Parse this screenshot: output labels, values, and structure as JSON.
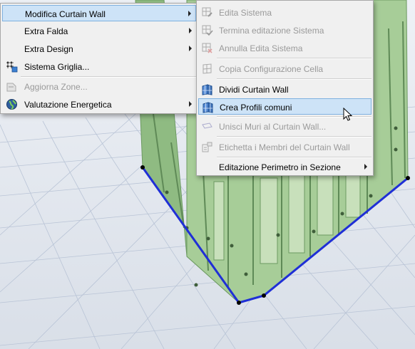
{
  "main_menu": {
    "items": [
      {
        "label": "Modifica Curtain Wall",
        "state": "highlighted",
        "submenu": true
      },
      {
        "label": "Extra Falda",
        "submenu": true
      },
      {
        "label": "Extra Design",
        "submenu": true
      },
      {
        "label": "Sistema Griglia...",
        "icon": "grid-system-icon"
      },
      {
        "label": "Aggiorna Zone...",
        "state": "disabled",
        "icon": "update-zones-icon"
      },
      {
        "label": "Valutazione Energetica",
        "submenu": true,
        "icon": "globe-icon"
      }
    ]
  },
  "sub_menu": {
    "items": [
      {
        "label": "Edita Sistema",
        "state": "disabled",
        "icon": "edit-system-icon"
      },
      {
        "label": "Termina editazione Sistema",
        "state": "disabled",
        "icon": "finish-edit-icon"
      },
      {
        "label": "Annulla Edita Sistema",
        "state": "disabled",
        "icon": "cancel-edit-icon"
      },
      {
        "label": "Copia Configurazione Cella",
        "state": "disabled",
        "icon": "copy-cell-icon"
      },
      {
        "label": "Dividi Curtain Wall",
        "icon": "divide-curtain-wall-icon"
      },
      {
        "label": "Crea Profili comuni",
        "state": "highlighted",
        "icon": "create-profiles-icon"
      },
      {
        "label": "Unisci Muri al Curtain Wall...",
        "state": "disabled",
        "icon": "merge-walls-icon"
      },
      {
        "label": "Etichetta i Membri del Curtain Wall",
        "state": "disabled",
        "icon": "label-members-icon"
      },
      {
        "label": "Editazione Perimetro in Sezione",
        "submenu": true
      }
    ]
  },
  "colors": {
    "menu_bg": "#f0f0f0",
    "highlight": "#cde3f7",
    "disabled_text": "#9a9a9a",
    "wall_green": "#9cc28c",
    "selection_blue": "#1f2fd6"
  }
}
